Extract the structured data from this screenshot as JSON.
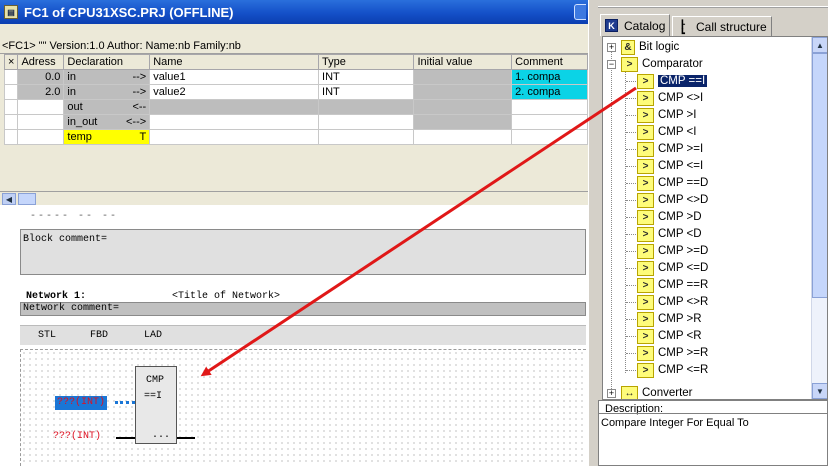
{
  "window": {
    "title": "FC1 of CPU31XSC.PRJ (OFFLINE)"
  },
  "block_info": "<FC1> \"\"   Version:1.0   Author:  Name:nb   Family:nb",
  "decl_table": {
    "headers": [
      "Adress",
      "Declaration",
      "Name",
      "Type",
      "Initial value",
      "Comment"
    ],
    "rows": [
      {
        "adr": "0.0",
        "decl": "in",
        "dir": "-->",
        "name": "value1",
        "type": "INT",
        "init": "",
        "comment": "1. compa"
      },
      {
        "adr": "2.0",
        "decl": "in",
        "dir": "-->",
        "name": "value2",
        "type": "INT",
        "init": "",
        "comment": "2. compa"
      },
      {
        "adr": "",
        "decl": "out",
        "dir": "<--",
        "name": "",
        "type": "",
        "init": "",
        "comment": ""
      },
      {
        "adr": "",
        "decl": "in_out",
        "dir": "<-->",
        "name": "",
        "type": "",
        "init": "",
        "comment": ""
      },
      {
        "adr": "",
        "decl": "temp",
        "dir": "T",
        "name": "",
        "type": "",
        "init": "",
        "comment": ""
      }
    ]
  },
  "editor": {
    "dashes": "----- -- --",
    "block_comment": "Block comment=",
    "network_label": "Network 1:",
    "network_title": "<Title of Network>",
    "network_comment": "Network comment=",
    "lang_tabs": [
      "STL",
      "FBD",
      "LAD"
    ],
    "cmp": {
      "title": "CMP",
      "op": "==I",
      "out": "..."
    },
    "input1": "???(INT)",
    "input2": "???(INT)"
  },
  "catalog": {
    "tabs": [
      "Catalog",
      "Call structure"
    ],
    "items": [
      "Bit logic",
      "Comparator",
      "CMP ==I",
      "CMP <>I",
      "CMP >I",
      "CMP <I",
      "CMP >=I",
      "CMP <=I",
      "CMP ==D",
      "CMP <>D",
      "CMP >D",
      "CMP <D",
      "CMP >=D",
      "CMP <=D",
      "CMP ==R",
      "CMP <>R",
      "CMP >R",
      "CMP <R",
      "CMP >=R",
      "CMP <=R",
      "Converter"
    ],
    "selected": "CMP ==I",
    "description_label": "Description:",
    "description_text": "Compare Integer For Equal To"
  },
  "colors": {
    "arrow": "#e01818",
    "title_bar": "#1450c8",
    "selection": "#0a246a",
    "temp_row": "#ffff00",
    "comment_cell": "#0bd3e6"
  }
}
